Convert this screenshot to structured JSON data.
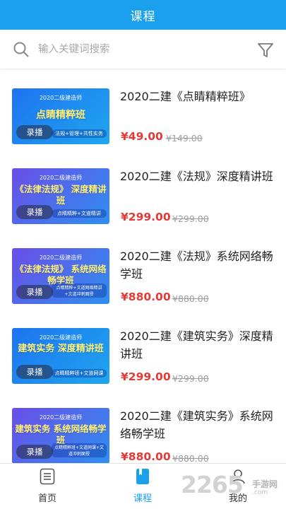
{
  "header": {
    "title": "课程"
  },
  "search": {
    "placeholder": "输入关键词搜索"
  },
  "icons": {
    "search": "search-icon",
    "filter": "filter-icon",
    "home": "list-icon",
    "courses": "book-icon",
    "me": "person-icon"
  },
  "colors": {
    "primary": "#1aa0ec",
    "price": "#e53935",
    "strike": "#9e9e9e"
  },
  "courses": [
    {
      "title": "2020二建《点睛精粹班》",
      "price": "¥49.00",
      "original_price": "¥149.00",
      "thumb_top": "2020二级建造师",
      "thumb_main": "点睛精粹班",
      "thumb_sub": "法规+管理+共性实务",
      "badge": "录播"
    },
    {
      "title": "2020二建《法规》深度精讲班",
      "price": "¥299.00",
      "original_price": "¥299.00",
      "thumb_top": "2020二级建造师",
      "thumb_main": "《法律法规》 深度精讲班",
      "thumb_sub": "点睛精粹+文道精讲",
      "badge": "录播"
    },
    {
      "title": "2020二建《法规》系统网络畅学班",
      "price": "¥880.00",
      "original_price": "¥880.00",
      "thumb_top": "2020二级建造师",
      "thumb_main": "《法律法规》 系统网络畅学班",
      "thumb_sub": "点睛精粹+文道网络精讲+文道冲刺面授",
      "badge": "录播"
    },
    {
      "title": "2020二建《建筑实务》深度精讲班",
      "price": "¥299.00",
      "original_price": "¥299.00",
      "thumb_top": "2020二级建造师",
      "thumb_main": "建筑实务 深度精讲班",
      "thumb_sub": "点睛精粹班+文道网课",
      "badge": "录播"
    },
    {
      "title": "2020二建《建筑实务》系统网络畅学班",
      "price": "¥880.00",
      "original_price": "¥880.00",
      "thumb_top": "2020二级建造师",
      "thumb_main": "建筑实务 系统网络畅学班",
      "thumb_sub": "点睛精粹班+文道网课+文道冲刺面授",
      "badge": "录播"
    }
  ],
  "tabbar": {
    "home": "首页",
    "courses": "课程",
    "me": "我的"
  },
  "watermark": {
    "number": "2265",
    "text": "手游网",
    "url": ".com"
  }
}
